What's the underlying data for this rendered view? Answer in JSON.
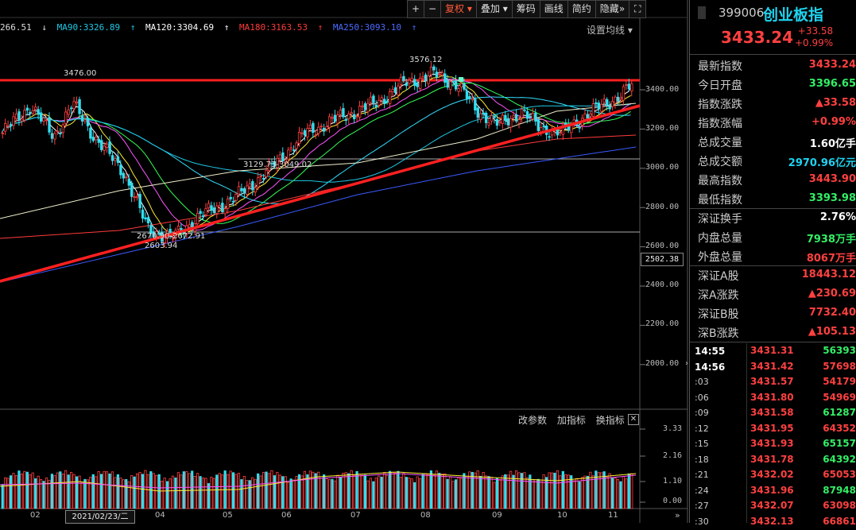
{
  "toolbar": {
    "plus_icon": "plus-icon",
    "minus_icon": "minus-icon",
    "fuquan": "复权",
    "diejia": "叠加",
    "chouma": "筹码",
    "huaxian": "画线",
    "jianyue": "简约",
    "yincang": "隐藏",
    "double_arrow": "»",
    "expand_icon": "expand-icon"
  },
  "ma_legend": {
    "ma_first": "266.51",
    "ma90": "MA90:3326.89",
    "ma120": "MA120:3304.69",
    "ma180": "MA180:3163.53",
    "ma250": "MA250:3093.10",
    "setting": "设置均线"
  },
  "colors": {
    "up": "#ff4040",
    "down": "#33ddee",
    "ma90": "#1ec8e6",
    "ma120": "#ffffff",
    "ma180": "#ff3b3b",
    "ma250": "#3a5bff",
    "name": "#1ed3f0",
    "green": "#33ee66"
  },
  "chart_data": {
    "type": "candlestick",
    "y_ticks": [
      "3400.00",
      "3200.00",
      "3000.00",
      "2800.00",
      "2600.00",
      "2400.00",
      "2200.00",
      "2000.00"
    ],
    "current_y_label": "2502.38",
    "x_ticks": [
      "02",
      "04",
      "05",
      "06",
      "07",
      "08",
      "09",
      "10",
      "11"
    ],
    "selected_date": "2021/02/23/二",
    "annotations": {
      "high_left": "3476.00",
      "peak": "3576.12",
      "low": "2603.94",
      "range_low": "2670.90-2672.91",
      "range_mid": "3129.73-3049.02"
    },
    "volume_ticks": [
      "3.33",
      "2.16",
      "1.10",
      "0.00"
    ],
    "indicator_buttons": [
      "改参数",
      "加指标",
      "换指标"
    ]
  },
  "header": {
    "code": "399006",
    "name": "创业板指",
    "price": "3433.24",
    "change": "+33.58",
    "change_pct": "+0.99%"
  },
  "stats": [
    {
      "label": "最新指数",
      "value": "3433.24",
      "color": "#ff4040"
    },
    {
      "label": "今日开盘",
      "value": "3396.65",
      "color": "#33ee66"
    },
    {
      "label": "指数涨跌",
      "value": "▲33.58",
      "color": "#ff4040"
    },
    {
      "label": "指数涨幅",
      "value": "+0.99%",
      "color": "#ff4040"
    },
    {
      "label": "总成交量",
      "value": "1.60亿手",
      "color": "#ffffff"
    },
    {
      "label": "总成交额",
      "value": "2970.96亿元",
      "color": "#1ed3f0"
    },
    {
      "label": "最高指数",
      "value": "3443.90",
      "color": "#ff4040"
    },
    {
      "label": "最低指数",
      "value": "3393.98",
      "color": "#33ee66"
    },
    {
      "label": "深证换手",
      "value": "2.76%",
      "color": "#ffffff"
    },
    {
      "label": "内盘总量",
      "value": "7938万手",
      "color": "#33ee66"
    },
    {
      "label": "外盘总量",
      "value": "8067万手",
      "color": "#ff4040"
    },
    {
      "label": "深证A股",
      "value": "18443.12",
      "color": "#ff4040"
    },
    {
      "label": "深A涨跌",
      "value": "▲230.69",
      "color": "#ff4040"
    },
    {
      "label": "深证B股",
      "value": "7732.40",
      "color": "#ff4040"
    },
    {
      "label": "深B涨跌",
      "value": "▲105.13",
      "color": "#ff4040"
    }
  ],
  "ticks": [
    {
      "time": "14:55",
      "price": "3431.31",
      "vol": "56393",
      "vcolor": "#33ee66"
    },
    {
      "time": "14:56",
      "price": "3431.42",
      "vol": "57698",
      "vcolor": "#ff4040"
    },
    {
      "time": ":03",
      "price": "3431.57",
      "vol": "54179",
      "vcolor": "#ff4040"
    },
    {
      "time": ":06",
      "price": "3431.80",
      "vol": "54969",
      "vcolor": "#ff4040"
    },
    {
      "time": ":09",
      "price": "3431.58",
      "vol": "61287",
      "vcolor": "#33ee66"
    },
    {
      "time": ":12",
      "price": "3431.95",
      "vol": "64352",
      "vcolor": "#ff4040"
    },
    {
      "time": ":15",
      "price": "3431.93",
      "vol": "65157",
      "vcolor": "#33ee66"
    },
    {
      "time": ":18",
      "price": "3431.78",
      "vol": "64392",
      "vcolor": "#33ee66"
    },
    {
      "time": ":21",
      "price": "3432.02",
      "vol": "65053",
      "vcolor": "#ff4040"
    },
    {
      "time": ":24",
      "price": "3431.96",
      "vol": "87948",
      "vcolor": "#33ee66"
    },
    {
      "time": ":27",
      "price": "3432.07",
      "vol": "63098",
      "vcolor": "#ff4040"
    },
    {
      "time": ":30",
      "price": "3432.13",
      "vol": "66861",
      "vcolor": "#ff4040"
    }
  ]
}
